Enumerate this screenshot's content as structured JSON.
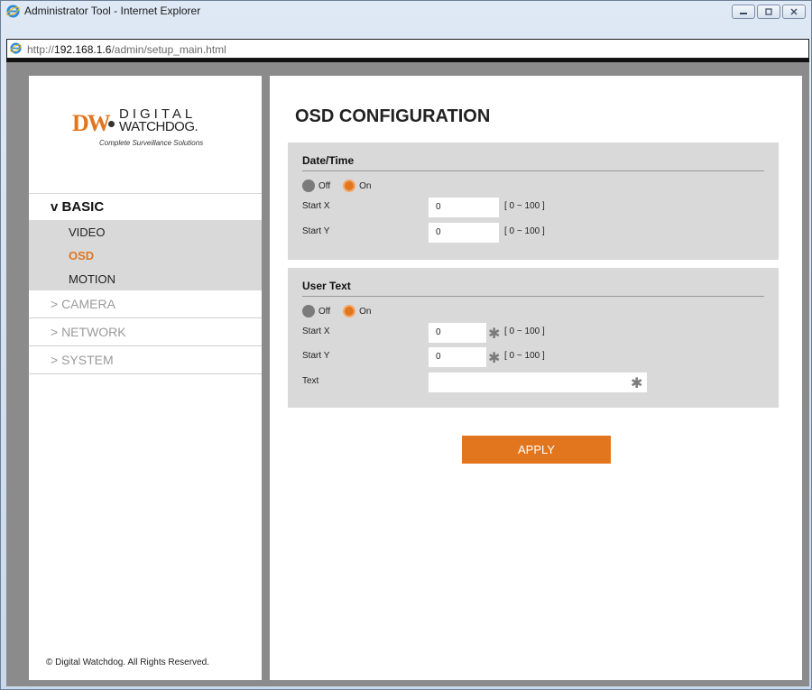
{
  "window": {
    "title": "Administrator Tool - Internet Explorer",
    "url_prefix": "http://",
    "url_host": "192.168.1.6",
    "url_path": "/admin/setup_main.html"
  },
  "logo": {
    "brand_mark": "DW",
    "line1": "DIGITAL",
    "line2": "WATCHDOG.",
    "tagline": "Complete Surveillance Solutions"
  },
  "nav": {
    "basic": "v BASIC",
    "basic_items": [
      "VIDEO",
      "OSD",
      "MOTION"
    ],
    "active_item": "OSD",
    "items": [
      "> CAMERA",
      "> NETWORK",
      "> SYSTEM"
    ]
  },
  "copyright": "© Digital Watchdog. All Rights Reserved.",
  "page": {
    "title": "OSD CONFIGURATION",
    "datetime": {
      "title": "Date/Time",
      "off_label": "Off",
      "on_label": "On",
      "selected": "On",
      "start_x_label": "Start X",
      "start_x_value": "0",
      "start_x_range": "[ 0 ~ 100 ]",
      "start_y_label": "Start Y",
      "start_y_value": "0",
      "start_y_range": "[ 0 ~ 100 ]"
    },
    "usertext": {
      "title": "User Text",
      "off_label": "Off",
      "on_label": "On",
      "selected": "On",
      "start_x_label": "Start X",
      "start_x_value": "0",
      "start_x_range": "[ 0 ~ 100 ]",
      "start_y_label": "Start Y",
      "start_y_value": "0",
      "start_y_range": "[ 0 ~ 100 ]",
      "text_label": "Text",
      "text_value": ""
    },
    "apply_label": "APPLY"
  },
  "colors": {
    "accent": "#e2761f",
    "panel_bg": "#d9d9d9",
    "canvas_bg": "#8b8b8b"
  }
}
